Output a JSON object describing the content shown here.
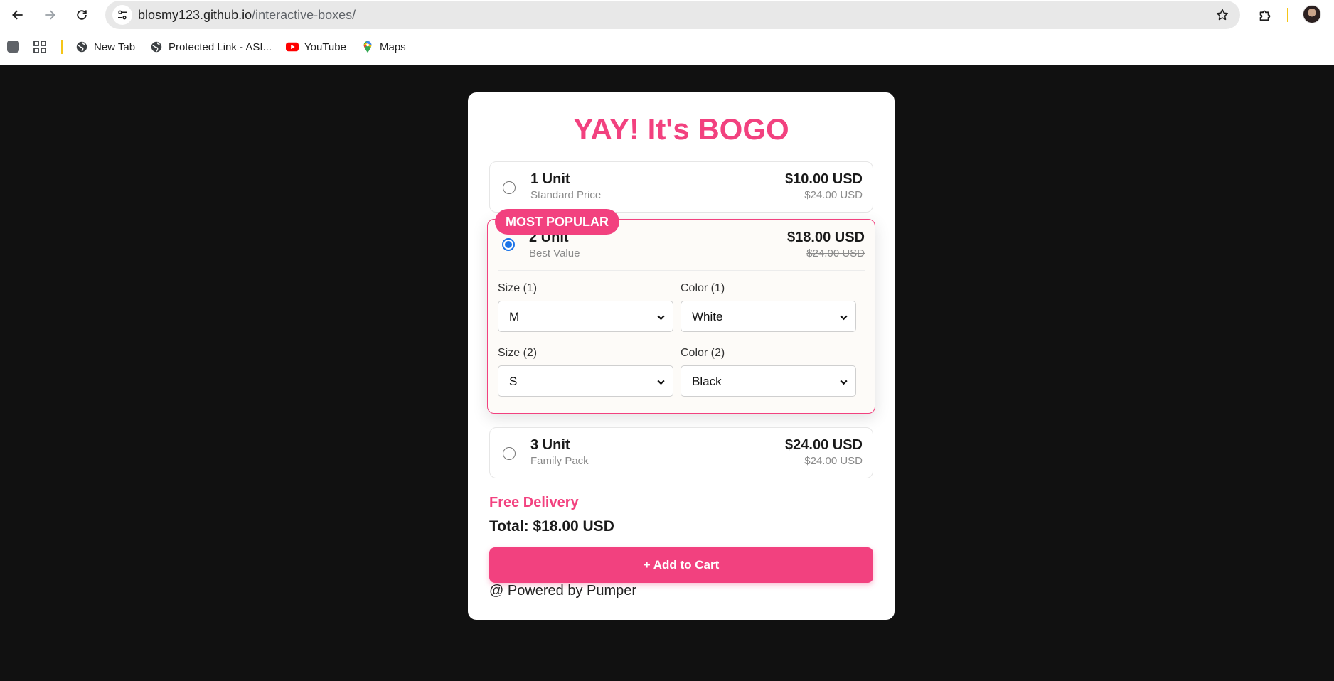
{
  "browser": {
    "url_host": "blosmy123.github.io",
    "url_path": "/interactive-boxes/",
    "bookmarks": [
      {
        "label": "New Tab",
        "icon": "globe-icon"
      },
      {
        "label": "Protected Link - ASI...",
        "icon": "globe-icon"
      },
      {
        "label": "YouTube",
        "icon": "youtube-icon"
      },
      {
        "label": "Maps",
        "icon": "maps-icon"
      }
    ]
  },
  "colors": {
    "accent": "#f2417f",
    "page_background": "#111111",
    "radio_selected": "#1a73e8"
  },
  "page": {
    "title": "YAY! It's BOGO",
    "selected_option": 1,
    "options": [
      {
        "name": "1 Unit",
        "subtitle": "Standard Price",
        "price": "$10.00 USD",
        "old_price": "$24.00 USD",
        "checked": false
      },
      {
        "name": "2 Unit",
        "subtitle": "Best Value",
        "price": "$18.00 USD",
        "old_price": "$24.00 USD",
        "checked": true,
        "badge": "MOST POPULAR"
      },
      {
        "name": "3 Unit",
        "subtitle": "Family Pack",
        "price": "$24.00 USD",
        "old_price": "$24.00 USD",
        "checked": false
      }
    ],
    "variants": [
      {
        "size_label": "Size (1)",
        "size_value": "M",
        "color_label": "Color (1)",
        "color_value": "White"
      },
      {
        "size_label": "Size (2)",
        "size_value": "S",
        "color_label": "Color (2)",
        "color_value": "Black"
      }
    ],
    "free_delivery": "Free Delivery",
    "total_label": "Total:",
    "total_value": "$18.00 USD",
    "add_to_cart": "+ Add to Cart",
    "powered_by": "@ Powered by Pumper"
  }
}
